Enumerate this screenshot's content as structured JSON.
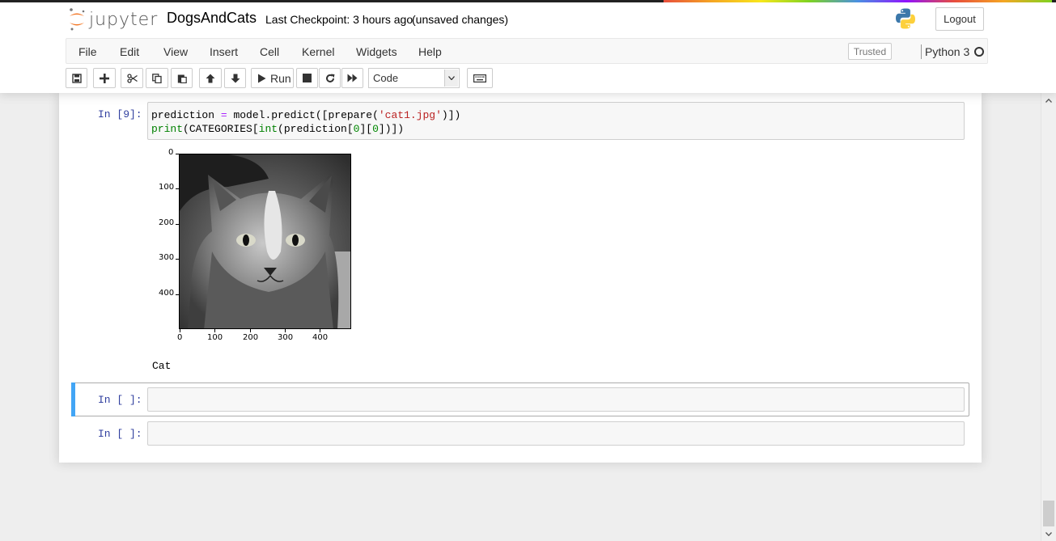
{
  "header": {
    "logo_text": "jupyter",
    "notebook_name": "DogsAndCats",
    "checkpoint": "Last Checkpoint: 3 hours ago",
    "autosave_status": "(unsaved changes)",
    "logout_label": "Logout"
  },
  "menubar": {
    "items": [
      "File",
      "Edit",
      "View",
      "Insert",
      "Cell",
      "Kernel",
      "Widgets",
      "Help"
    ],
    "trusted_label": "Trusted",
    "kernel_name": "Python 3"
  },
  "toolbar": {
    "run_label": "Run",
    "cell_type": "Code",
    "icons": [
      "save-icon",
      "plus-icon",
      "cut-icon",
      "copy-icon",
      "paste-icon",
      "arrow-up-icon",
      "arrow-down-icon",
      "play-icon",
      "stop-icon",
      "restart-icon",
      "fast-forward-icon",
      "keyboard-icon"
    ]
  },
  "cells": [
    {
      "prompt": "In [9]:",
      "code_line1": {
        "a": "prediction ",
        "op": "=",
        "b": " model.predict([prepare(",
        "str": "'cat1.jpg'",
        "c": ")])"
      },
      "code_line2": {
        "kw1": "print",
        "a": "(CATEGORIES[",
        "kw2": "int",
        "b": "(prediction[",
        "n1": "0",
        "c": "][",
        "n2": "0",
        "d": "])])"
      },
      "output": {
        "plot": {
          "y_ticks": [
            "0",
            "100",
            "200",
            "300",
            "400"
          ],
          "x_ticks": [
            "0",
            "100",
            "200",
            "300",
            "400"
          ],
          "image": "grayscale cat photo"
        },
        "text": "Cat"
      }
    },
    {
      "prompt": "In [ ]:",
      "selected": true
    },
    {
      "prompt": "In [ ]:",
      "selected": false
    }
  ]
}
